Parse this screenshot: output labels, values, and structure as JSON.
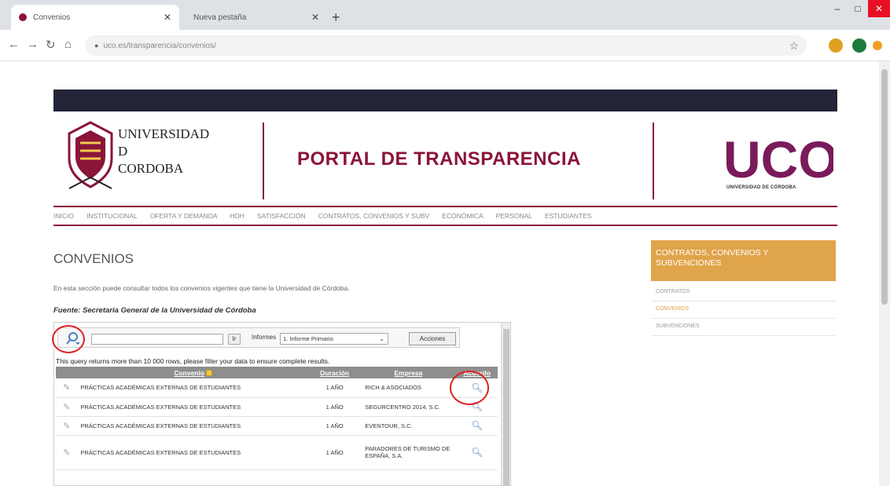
{
  "browser": {
    "tabs": [
      {
        "title": "Convenios",
        "active": true
      },
      {
        "title": "Nueva pestaña",
        "active": false
      }
    ],
    "url": "uco.es/transparencia/convenios/"
  },
  "header": {
    "university_name": [
      "UNIVERSIDAD",
      "D",
      "CORDOBA"
    ],
    "portal_title": "PORTAL DE TRANSPARENCIA",
    "logo_text": "UCO",
    "logo_subtitle": "UNIVERSIDAD DE CÓRDOBA"
  },
  "nav": {
    "items": [
      "INICIO",
      "INSTITUCIONAL",
      "OFERTA Y DEMANDA",
      "HDH",
      "SATISFACCIÓN",
      "CONTRATOS, CONVENIOS Y SUBV",
      "ECONÓMICA",
      "PERSONAL",
      "ESTUDIANTES"
    ]
  },
  "main": {
    "heading": "CONVENIOS",
    "intro": "En esta sección puede consultar todos los convenios vigentes que tiene la Universidad de Córdoba.",
    "source": "Fuente: Secretaria General de la Universidad de Córdoba"
  },
  "sidebar": {
    "title": "CONTRATOS, CONVENIOS Y SUBVENCIONES",
    "links": [
      "CONTRATOS",
      "CONVENIOS",
      "SUBVENCIONES"
    ]
  },
  "report": {
    "go_label": "Ir",
    "reports_label": "Informes",
    "selected_report": "1. Informe Primario",
    "actions_label": "Acciones",
    "message": "This query returns more than 10 000 rows, please filter your data to ensure complete results.",
    "columns": [
      "Convenio",
      "Duración",
      "Empresa",
      "Acuerdo"
    ],
    "rows": [
      {
        "convenio": "PRÁCTICAS ACADÉMICAS EXTERNAS DE ESTUDIANTES",
        "duracion": "1 AÑO",
        "empresa": "RICH & ASOCIADOS"
      },
      {
        "convenio": "PRÁCTICAS ACADÉMICAS EXTERNAS DE ESTUDIANTES",
        "duracion": "1 AÑO",
        "empresa": "SEGURCENTRO 2014, S.C."
      },
      {
        "convenio": "PRÁCTICAS ACADÉMICAS EXTERNAS DE ESTUDIANTES",
        "duracion": "1 AÑO",
        "empresa": "EVENTOUR, S.C."
      },
      {
        "convenio": "PRÁCTICAS ACADÉMICAS EXTERNAS DE ESTUDIANTES",
        "duracion": "1 AÑO",
        "empresa": "PARADORES DE TURISMO DE ESPAÑA, S.A."
      }
    ]
  },
  "icons": {
    "search": "magnifier-icon",
    "edit": "edit-pencil-icon",
    "view": "view-magnifier-icon"
  },
  "colors": {
    "brand": "#8a1538",
    "accent": "#e0a44a",
    "topband": "#232437",
    "annotation": "#e02020"
  }
}
